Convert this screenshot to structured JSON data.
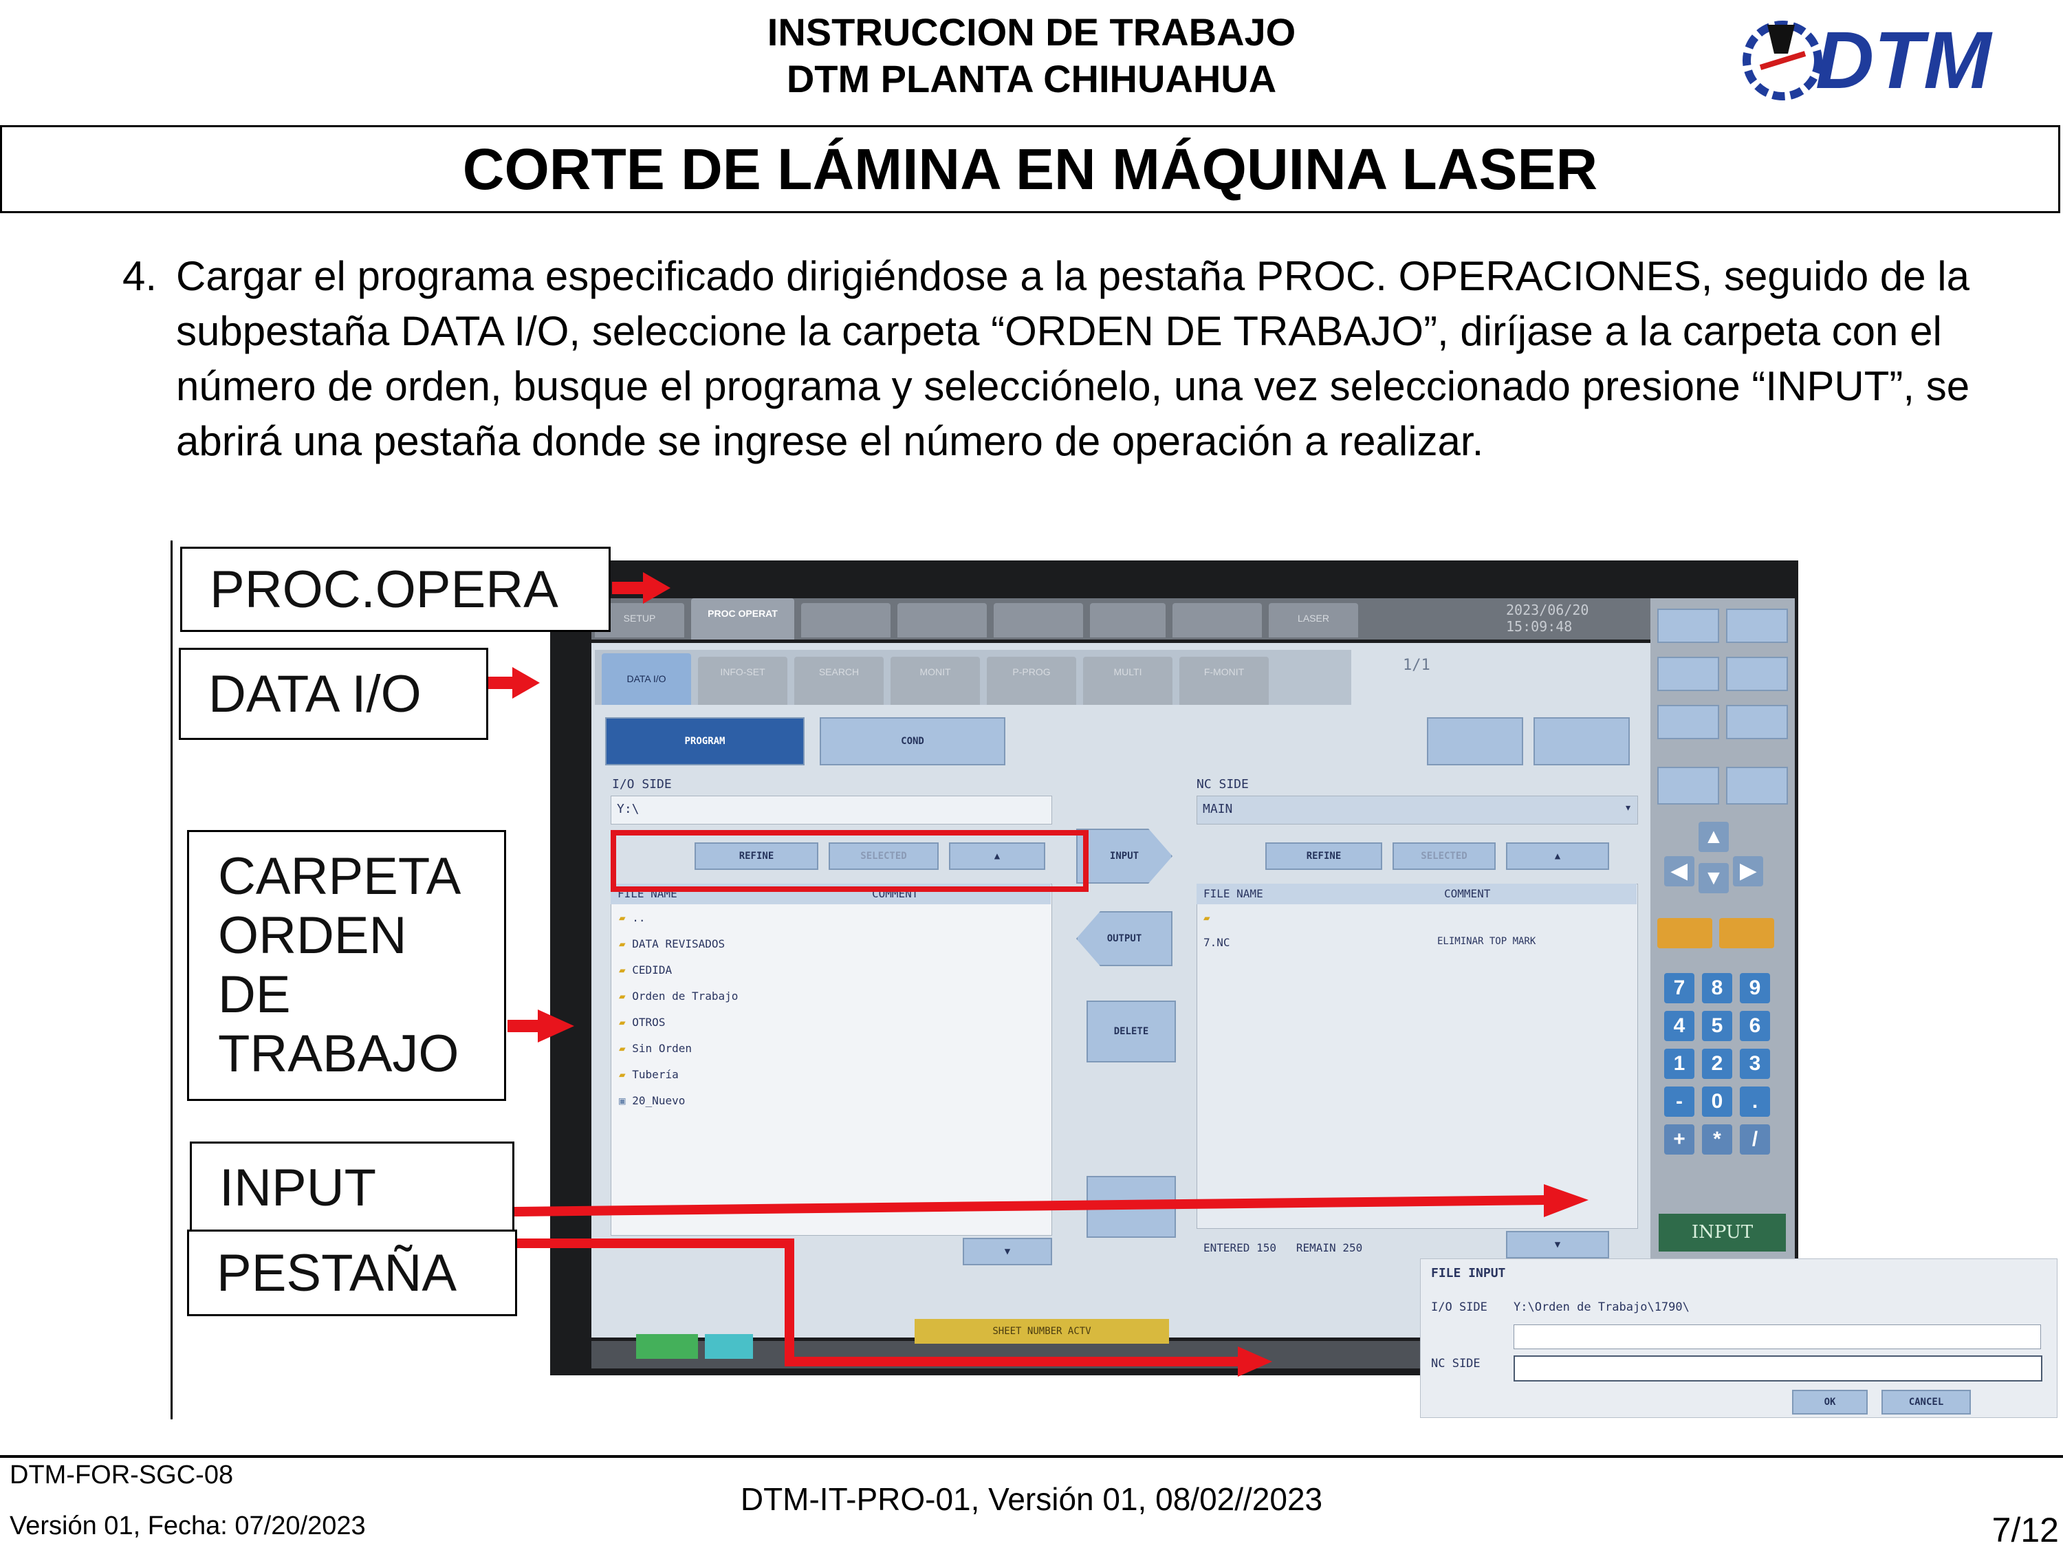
{
  "header": {
    "line1": "INSTRUCCION DE TRABAJO",
    "line2": "DTM PLANTA CHIHUAHUA",
    "logo_text": "DTM",
    "title": "CORTE DE LÁMINA EN MÁQUINA LASER"
  },
  "instruction": {
    "number": "4.",
    "text": "Cargar el programa especificado dirigiéndose a la pestaña PROC. OPERACIONES, seguido de la subpestaña DATA I/O, seleccione la carpeta “ORDEN DE TRABAJO”, diríjase a la carpeta con el número de orden, busque el programa y selecciónelo, una vez seleccionado presione “INPUT”, se abrirá una pestaña donde se ingrese el número de operación a realizar."
  },
  "callouts": {
    "proc_opera": "PROC.OPERA",
    "data_io": "DATA I/O",
    "carpeta": [
      "CARPETA",
      "ORDEN",
      "DE",
      "TRABAJO"
    ],
    "input": "INPUT",
    "pestana": "PESTAÑA"
  },
  "screen": {
    "top_tabs": [
      "SETUP",
      "PROC OPERAT",
      "",
      "",
      "",
      "",
      "",
      "LASER"
    ],
    "active_tab": "PROC OPERAT",
    "datetime": [
      "2023/06/20",
      "15:09:48"
    ],
    "sub_tabs": [
      "DATA I/O",
      "INFO-SET",
      "SEARCH",
      "MONIT",
      "P-PROG",
      "MULTI",
      "F-MONIT"
    ],
    "page": "1/1",
    "program_btn": "PROGRAM",
    "cond_btn": "COND",
    "io_side": "I/O SIDE",
    "io_path": "Y:\\",
    "nc_side": "NC SIDE",
    "nc_path": "MAIN",
    "refine": "REFINE",
    "selected": "SELECTED",
    "input_arrow": "INPUT",
    "output_arrow": "OUTPUT",
    "delete_btn": "DELETE",
    "file_name_hdr": "FILE NAME",
    "comment_hdr": "COMMENT",
    "folders": [
      "..",
      "DATA REVISADOS",
      "CEDIDA",
      "Orden de Trabajo",
      "OTROS",
      "Sin Orden",
      "Tubería",
      "20_Nuevo"
    ],
    "nc_files": [
      "",
      "7.NC"
    ],
    "nc_file_comment": "ELIMINAR TOP MARK",
    "entered_label": "ENTERED",
    "entered_value": "150",
    "remain_label": "REMAIN",
    "remain_value": "250",
    "input_key": "INPUT",
    "keypad": [
      "7",
      "8",
      "9",
      "4",
      "5",
      "6",
      "1",
      "2",
      "3",
      "-",
      "0",
      "."
    ],
    "bottom_bar_text": "SHEET NUMBER ACTV",
    "dialog": {
      "title": "FILE INPUT",
      "io_side_label": "I/O SIDE",
      "io_side_value": "Y:\\Orden de Trabajo\\1790\\",
      "nc_side_label": "NC SIDE",
      "ok": "OK",
      "cancel": "CANCEL"
    }
  },
  "footer": {
    "form_code": "DTM-FOR-SGC-08",
    "version": "Versión 01, Fecha: 07/20/2023",
    "doc_ref": "DTM-IT-PRO-01, Versión 01, 08/02//2023",
    "page": "7/12"
  },
  "colors": {
    "accent_red": "#e1141c",
    "logo_blue": "#1f3c9c"
  }
}
